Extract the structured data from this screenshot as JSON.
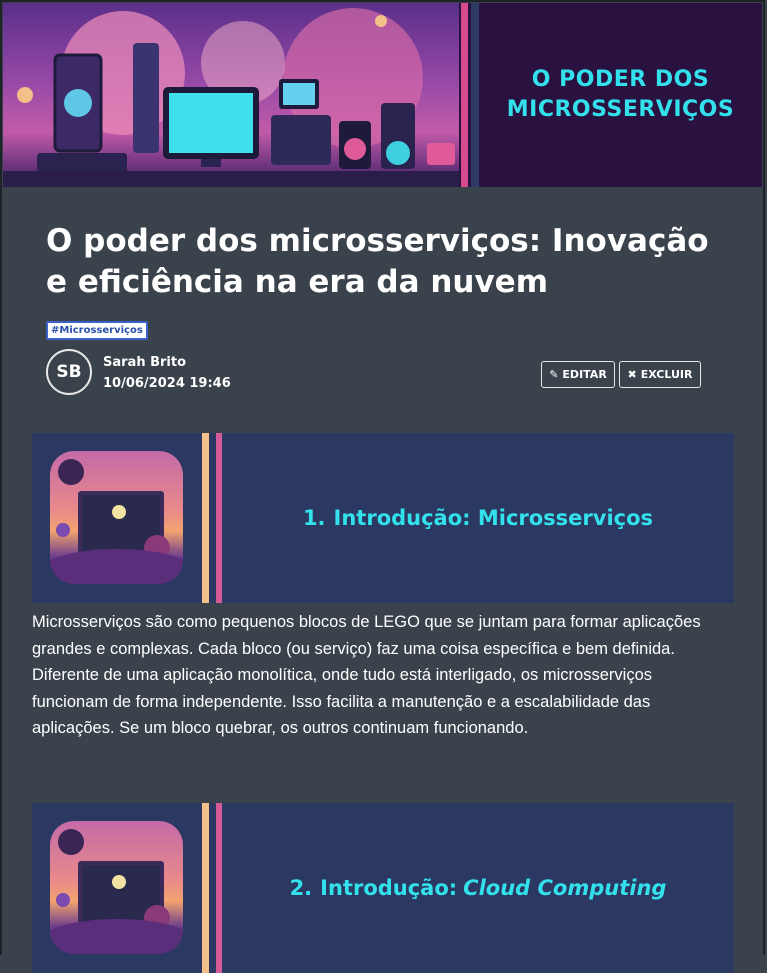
{
  "banner": {
    "title": "O PODER DOS\nMICROSSERVIÇOS"
  },
  "post": {
    "title": "O poder dos microsserviços: Inovação e eficiência na era da nuvem",
    "tag": "#Microsserviços",
    "author": {
      "initials": "SB",
      "name": "Sarah Brito",
      "date": "10/06/2024 19:46"
    },
    "actions": {
      "edit_label": "EDITAR",
      "delete_label": "EXCLUIR"
    }
  },
  "sections": [
    {
      "number": "1.",
      "heading": "Introdução: Microsserviços",
      "body": "Microsserviços são como pequenos blocos de LEGO que se juntam para formar aplicações grandes e complexas. Cada bloco (ou serviço) faz uma coisa específica e bem definida. Diferente de uma aplicação monolítica, onde tudo está interligado, os microsserviços funcionam de forma independente. Isso facilita a manutenção e a escalabilidade das aplicações. Se um bloco quebrar, os outros continuam funcionando."
    },
    {
      "number": "2.",
      "heading_prefix": "Introdução:",
      "heading_emphasis": "Cloud Computing"
    }
  ],
  "colors": {
    "accent_cyan": "#33e1ec",
    "page_bg": "#3a424b",
    "card_bg": "#2b3962",
    "stripe_pink": "#d84a8e"
  }
}
